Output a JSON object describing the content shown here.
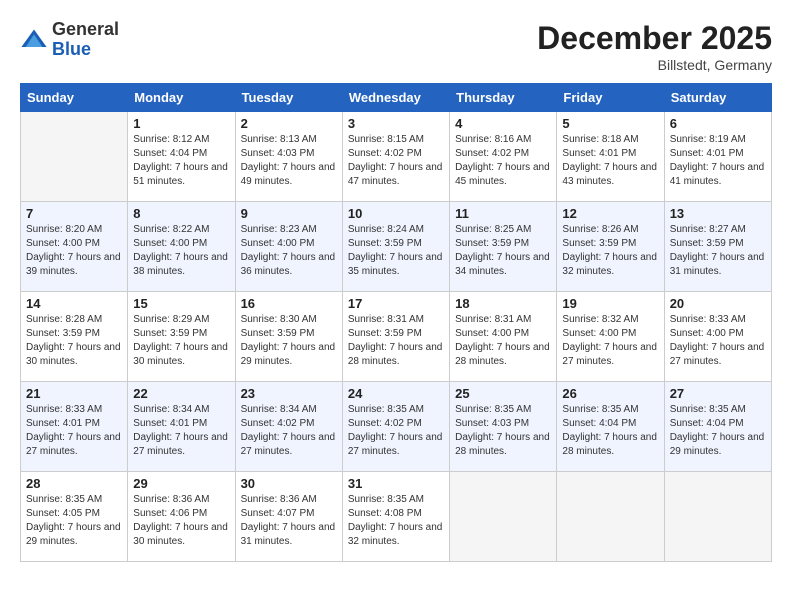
{
  "logo": {
    "general": "General",
    "blue": "Blue"
  },
  "header": {
    "month": "December 2025",
    "location": "Billstedt, Germany"
  },
  "weekdays": [
    "Sunday",
    "Monday",
    "Tuesday",
    "Wednesday",
    "Thursday",
    "Friday",
    "Saturday"
  ],
  "weeks": [
    [
      {
        "day": null,
        "sunrise": null,
        "sunset": null,
        "daylight": null
      },
      {
        "day": "1",
        "sunrise": "Sunrise: 8:12 AM",
        "sunset": "Sunset: 4:04 PM",
        "daylight": "Daylight: 7 hours and 51 minutes."
      },
      {
        "day": "2",
        "sunrise": "Sunrise: 8:13 AM",
        "sunset": "Sunset: 4:03 PM",
        "daylight": "Daylight: 7 hours and 49 minutes."
      },
      {
        "day": "3",
        "sunrise": "Sunrise: 8:15 AM",
        "sunset": "Sunset: 4:02 PM",
        "daylight": "Daylight: 7 hours and 47 minutes."
      },
      {
        "day": "4",
        "sunrise": "Sunrise: 8:16 AM",
        "sunset": "Sunset: 4:02 PM",
        "daylight": "Daylight: 7 hours and 45 minutes."
      },
      {
        "day": "5",
        "sunrise": "Sunrise: 8:18 AM",
        "sunset": "Sunset: 4:01 PM",
        "daylight": "Daylight: 7 hours and 43 minutes."
      },
      {
        "day": "6",
        "sunrise": "Sunrise: 8:19 AM",
        "sunset": "Sunset: 4:01 PM",
        "daylight": "Daylight: 7 hours and 41 minutes."
      }
    ],
    [
      {
        "day": "7",
        "sunrise": "Sunrise: 8:20 AM",
        "sunset": "Sunset: 4:00 PM",
        "daylight": "Daylight: 7 hours and 39 minutes."
      },
      {
        "day": "8",
        "sunrise": "Sunrise: 8:22 AM",
        "sunset": "Sunset: 4:00 PM",
        "daylight": "Daylight: 7 hours and 38 minutes."
      },
      {
        "day": "9",
        "sunrise": "Sunrise: 8:23 AM",
        "sunset": "Sunset: 4:00 PM",
        "daylight": "Daylight: 7 hours and 36 minutes."
      },
      {
        "day": "10",
        "sunrise": "Sunrise: 8:24 AM",
        "sunset": "Sunset: 3:59 PM",
        "daylight": "Daylight: 7 hours and 35 minutes."
      },
      {
        "day": "11",
        "sunrise": "Sunrise: 8:25 AM",
        "sunset": "Sunset: 3:59 PM",
        "daylight": "Daylight: 7 hours and 34 minutes."
      },
      {
        "day": "12",
        "sunrise": "Sunrise: 8:26 AM",
        "sunset": "Sunset: 3:59 PM",
        "daylight": "Daylight: 7 hours and 32 minutes."
      },
      {
        "day": "13",
        "sunrise": "Sunrise: 8:27 AM",
        "sunset": "Sunset: 3:59 PM",
        "daylight": "Daylight: 7 hours and 31 minutes."
      }
    ],
    [
      {
        "day": "14",
        "sunrise": "Sunrise: 8:28 AM",
        "sunset": "Sunset: 3:59 PM",
        "daylight": "Daylight: 7 hours and 30 minutes."
      },
      {
        "day": "15",
        "sunrise": "Sunrise: 8:29 AM",
        "sunset": "Sunset: 3:59 PM",
        "daylight": "Daylight: 7 hours and 30 minutes."
      },
      {
        "day": "16",
        "sunrise": "Sunrise: 8:30 AM",
        "sunset": "Sunset: 3:59 PM",
        "daylight": "Daylight: 7 hours and 29 minutes."
      },
      {
        "day": "17",
        "sunrise": "Sunrise: 8:31 AM",
        "sunset": "Sunset: 3:59 PM",
        "daylight": "Daylight: 7 hours and 28 minutes."
      },
      {
        "day": "18",
        "sunrise": "Sunrise: 8:31 AM",
        "sunset": "Sunset: 4:00 PM",
        "daylight": "Daylight: 7 hours and 28 minutes."
      },
      {
        "day": "19",
        "sunrise": "Sunrise: 8:32 AM",
        "sunset": "Sunset: 4:00 PM",
        "daylight": "Daylight: 7 hours and 27 minutes."
      },
      {
        "day": "20",
        "sunrise": "Sunrise: 8:33 AM",
        "sunset": "Sunset: 4:00 PM",
        "daylight": "Daylight: 7 hours and 27 minutes."
      }
    ],
    [
      {
        "day": "21",
        "sunrise": "Sunrise: 8:33 AM",
        "sunset": "Sunset: 4:01 PM",
        "daylight": "Daylight: 7 hours and 27 minutes."
      },
      {
        "day": "22",
        "sunrise": "Sunrise: 8:34 AM",
        "sunset": "Sunset: 4:01 PM",
        "daylight": "Daylight: 7 hours and 27 minutes."
      },
      {
        "day": "23",
        "sunrise": "Sunrise: 8:34 AM",
        "sunset": "Sunset: 4:02 PM",
        "daylight": "Daylight: 7 hours and 27 minutes."
      },
      {
        "day": "24",
        "sunrise": "Sunrise: 8:35 AM",
        "sunset": "Sunset: 4:02 PM",
        "daylight": "Daylight: 7 hours and 27 minutes."
      },
      {
        "day": "25",
        "sunrise": "Sunrise: 8:35 AM",
        "sunset": "Sunset: 4:03 PM",
        "daylight": "Daylight: 7 hours and 28 minutes."
      },
      {
        "day": "26",
        "sunrise": "Sunrise: 8:35 AM",
        "sunset": "Sunset: 4:04 PM",
        "daylight": "Daylight: 7 hours and 28 minutes."
      },
      {
        "day": "27",
        "sunrise": "Sunrise: 8:35 AM",
        "sunset": "Sunset: 4:04 PM",
        "daylight": "Daylight: 7 hours and 29 minutes."
      }
    ],
    [
      {
        "day": "28",
        "sunrise": "Sunrise: 8:35 AM",
        "sunset": "Sunset: 4:05 PM",
        "daylight": "Daylight: 7 hours and 29 minutes."
      },
      {
        "day": "29",
        "sunrise": "Sunrise: 8:36 AM",
        "sunset": "Sunset: 4:06 PM",
        "daylight": "Daylight: 7 hours and 30 minutes."
      },
      {
        "day": "30",
        "sunrise": "Sunrise: 8:36 AM",
        "sunset": "Sunset: 4:07 PM",
        "daylight": "Daylight: 7 hours and 31 minutes."
      },
      {
        "day": "31",
        "sunrise": "Sunrise: 8:35 AM",
        "sunset": "Sunset: 4:08 PM",
        "daylight": "Daylight: 7 hours and 32 minutes."
      },
      {
        "day": null,
        "sunrise": null,
        "sunset": null,
        "daylight": null
      },
      {
        "day": null,
        "sunrise": null,
        "sunset": null,
        "daylight": null
      },
      {
        "day": null,
        "sunrise": null,
        "sunset": null,
        "daylight": null
      }
    ]
  ]
}
